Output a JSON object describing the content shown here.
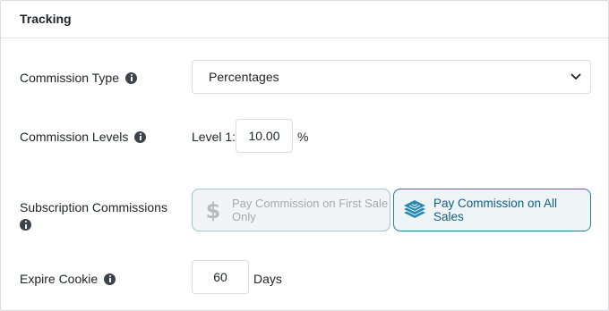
{
  "section": {
    "title": "Tracking"
  },
  "commission_type": {
    "label": "Commission Type",
    "selected": "Percentages"
  },
  "commission_levels": {
    "label": "Commission Levels",
    "level_label": "Level 1:",
    "value": "10.00",
    "unit": "%"
  },
  "subscription_commissions": {
    "label": "Subscription Commissions",
    "options": [
      {
        "label": "Pay Commission on First Sale Only",
        "icon": "dollar-icon",
        "selected": false
      },
      {
        "label": "Pay Commission on All Sales",
        "icon": "stack-icon",
        "selected": true
      }
    ]
  },
  "expire_cookie": {
    "label": "Expire Cookie",
    "value": "60",
    "unit": "Days"
  },
  "colors": {
    "accent": "#135e7f",
    "accent_border": "#2a7e9c",
    "muted_border": "#9fc4cf",
    "muted_text": "#a7aaad"
  }
}
